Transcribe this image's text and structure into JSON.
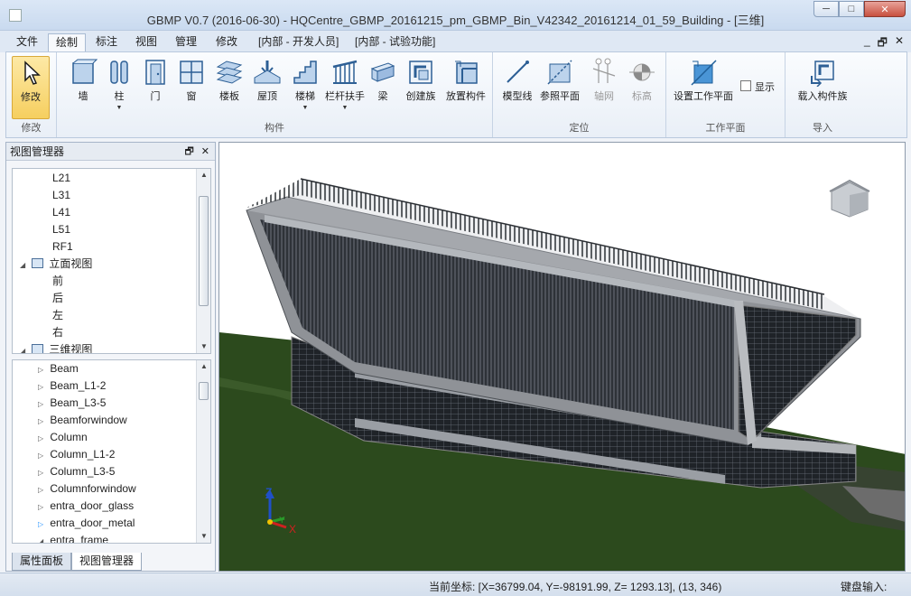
{
  "window": {
    "title": "GBMP V0.7 (2016-06-30) - HQCentre_GBMP_20161215_pm_GBMP_Bin_V42342_20161214_01_59_Building - [三维]",
    "controls": {
      "minimize": "─",
      "maximize": "□",
      "close": "✕"
    }
  },
  "menu": {
    "tabs": [
      "文件",
      "绘制",
      "标注",
      "视图",
      "管理",
      "修改",
      "[内部 - 开发人员]",
      "[内部 - 试验功能]"
    ],
    "active": "绘制",
    "mdi": {
      "minimize": "_",
      "restore": "🗗",
      "close": "✕"
    }
  },
  "ribbon": {
    "groups": {
      "modify": {
        "label": "修改",
        "btn_modify": "修改"
      },
      "component": {
        "label": "构件",
        "btn_wall": "墙",
        "btn_column": "柱",
        "btn_door": "门",
        "btn_window": "窗",
        "btn_floor": "楼板",
        "btn_roof": "屋顶",
        "btn_stair": "楼梯",
        "btn_railing": "栏杆扶手",
        "btn_beam": "梁",
        "btn_create_family": "创建族",
        "btn_place": "放置构件"
      },
      "locate": {
        "label": "定位",
        "btn_model_line": "模型线",
        "btn_ref_plane": "参照平面",
        "btn_grid": "轴网",
        "btn_level": "标高"
      },
      "workplane": {
        "label": "工作平面",
        "btn_set": "设置工作平面",
        "show": "显示"
      },
      "import": {
        "label": "导入",
        "btn_load_family": "载入构件族"
      }
    }
  },
  "left_panel": {
    "title": "视图管理器",
    "tree_top": {
      "rows": [
        {
          "text": "L21",
          "indent": 2
        },
        {
          "text": "L31",
          "indent": 2
        },
        {
          "text": "L41",
          "indent": 2
        },
        {
          "text": "L51",
          "indent": 2
        },
        {
          "text": "RF1",
          "indent": 2
        },
        {
          "text": "立面视图",
          "indent": 0,
          "expanded": true,
          "icon": true
        },
        {
          "text": "前",
          "indent": 2
        },
        {
          "text": "后",
          "indent": 2
        },
        {
          "text": "左",
          "indent": 2
        },
        {
          "text": "右",
          "indent": 2
        },
        {
          "text": "三维视图",
          "indent": 0,
          "expanded": true,
          "icon": true
        }
      ]
    },
    "tree_bottom": {
      "rows": [
        "Beam",
        "Beam_L1-2",
        "Beam_L3-5",
        "Beamforwindow",
        "Column",
        "Column_L1-2",
        "Column_L3-5",
        "Columnforwindow",
        "entra_door_glass",
        "entra_door_metal",
        "entra_frame"
      ]
    },
    "tabs": [
      "属性面板",
      "视图管理器"
    ],
    "active_tab": "视图管理器"
  },
  "viewport": {
    "axis": {
      "z": "Z",
      "y": "Y",
      "x": "X"
    },
    "colors": {
      "ground": "#2c4a1d",
      "frame": "#8f9297",
      "glass": "#2b2f35",
      "background": "#ffffff"
    }
  },
  "status": {
    "coords": "当前坐标: [X=36799.04, Y=-98191.99, Z= 1293.13], (13, 346)",
    "keyboard": "键盘输入:"
  }
}
